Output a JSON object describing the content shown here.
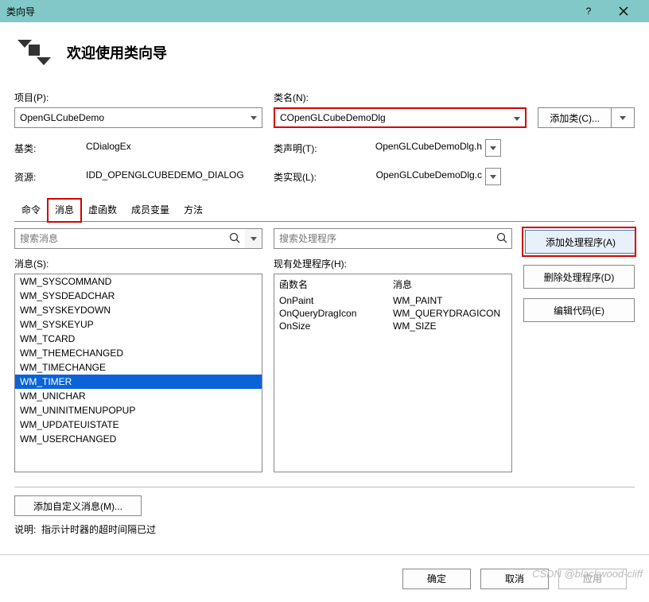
{
  "title": "类向导",
  "welcome": "欢迎使用类向导",
  "labels": {
    "project": "项目(P):",
    "className": "类名(N):",
    "baseClass": "基类:",
    "resource": "资源:",
    "classDecl": "类声明(T):",
    "classImpl": "类实现(L):",
    "messagesList": "消息(S):",
    "handlersList": "现有处理程序(H):",
    "funcName": "函数名",
    "msgCol": "消息",
    "desc": "说明:",
    "descText": "指示计时器的超时间隔已过"
  },
  "values": {
    "project": "OpenGLCubeDemo",
    "className": "COpenGLCubeDemoDlg",
    "baseClass": "CDialogEx",
    "resource": "IDD_OPENGLCUBEDEMO_DIALOG",
    "classDecl": "OpenGLCubeDemoDlg.h",
    "classImpl": "OpenGLCubeDemoDlg.c"
  },
  "buttons": {
    "addClass": "添加类(C)...",
    "addHandler": "添加处理程序(A)",
    "delHandler": "删除处理程序(D)",
    "editCode": "编辑代码(E)",
    "addCustom": "添加自定义消息(M)...",
    "ok": "确定",
    "cancel": "取消",
    "apply": "应用"
  },
  "search": {
    "messagesPlaceholder": "搜索消息",
    "handlersPlaceholder": "搜索处理程序"
  },
  "tabs": [
    "命令",
    "消息",
    "虚函数",
    "成员变量",
    "方法"
  ],
  "activeTab": 1,
  "messages": [
    "WM_SYSCOMMAND",
    "WM_SYSDEADCHAR",
    "WM_SYSKEYDOWN",
    "WM_SYSKEYUP",
    "WM_TCARD",
    "WM_THEMECHANGED",
    "WM_TIMECHANGE",
    "WM_TIMER",
    "WM_UNICHAR",
    "WM_UNINITMENUPOPUP",
    "WM_UPDATEUISTATE",
    "WM_USERCHANGED"
  ],
  "selectedMessage": "WM_TIMER",
  "handlers": [
    {
      "func": "OnPaint",
      "msg": "WM_PAINT"
    },
    {
      "func": "OnQueryDragIcon",
      "msg": "WM_QUERYDRAGICON"
    },
    {
      "func": "OnSize",
      "msg": "WM_SIZE"
    }
  ],
  "watermark": "CSDN @blackwood-cliff"
}
